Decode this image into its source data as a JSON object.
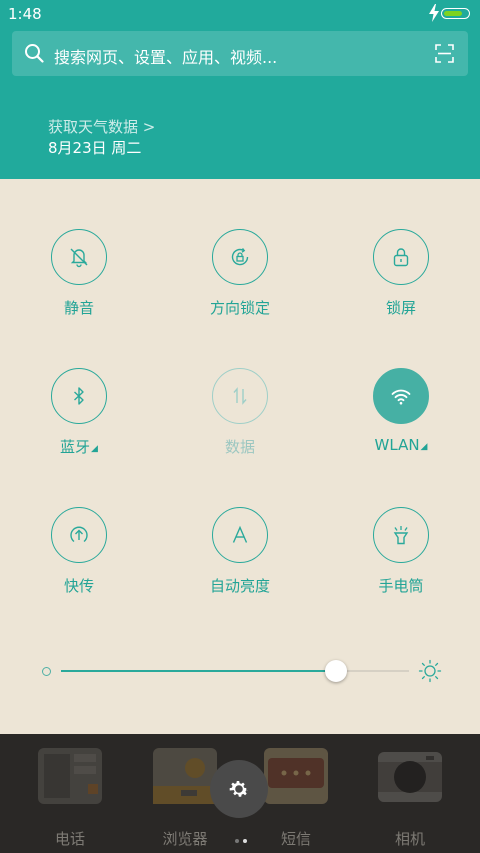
{
  "status_bar": {
    "time": "1:48",
    "battery_level": 0.8,
    "battery_color": "#7ed321",
    "charging_icon": "bolt-icon"
  },
  "search": {
    "placeholder": "搜索网页、设置、应用、视频...",
    "icon": "search-icon",
    "scan_icon": "scan-icon"
  },
  "weather": {
    "link": "获取天气数据 >",
    "date": "8月23日 周二"
  },
  "colors": {
    "header": "#21aa9c",
    "panel": "#ede5d6",
    "accent": "#2aa99b",
    "dock": "#2a2826"
  },
  "toggles": [
    {
      "label": "静音",
      "icon": "mute-bell-icon",
      "state": "off"
    },
    {
      "label": "方向锁定",
      "icon": "rotation-lock-icon",
      "state": "off"
    },
    {
      "label": "锁屏",
      "icon": "lock-icon",
      "state": "off"
    },
    {
      "label": "蓝牙",
      "icon": "bluetooth-icon",
      "state": "off",
      "expand": "◢"
    },
    {
      "label": "数据",
      "icon": "mobile-data-icon",
      "state": "disabled"
    },
    {
      "label": "WLAN",
      "icon": "wifi-icon",
      "state": "on",
      "expand": "◢"
    },
    {
      "label": "快传",
      "icon": "transfer-icon",
      "state": "off"
    },
    {
      "label": "自动亮度",
      "icon": "auto-brightness-icon",
      "state": "off"
    },
    {
      "label": "手电筒",
      "icon": "flashlight-icon",
      "state": "off"
    }
  ],
  "brightness": {
    "value": 0.79,
    "min_icon": "brightness-low-icon",
    "max_icon": "brightness-high-icon"
  },
  "dock": {
    "apps": [
      {
        "label": "电话",
        "icon": "phone-app-icon"
      },
      {
        "label": "浏览器",
        "icon": "browser-app-icon"
      },
      {
        "label": "短信",
        "icon": "messages-app-icon"
      },
      {
        "label": "相机",
        "icon": "camera-app-icon"
      }
    ],
    "settings_icon": "gear-icon",
    "page_count": 2,
    "active_page": 2
  }
}
